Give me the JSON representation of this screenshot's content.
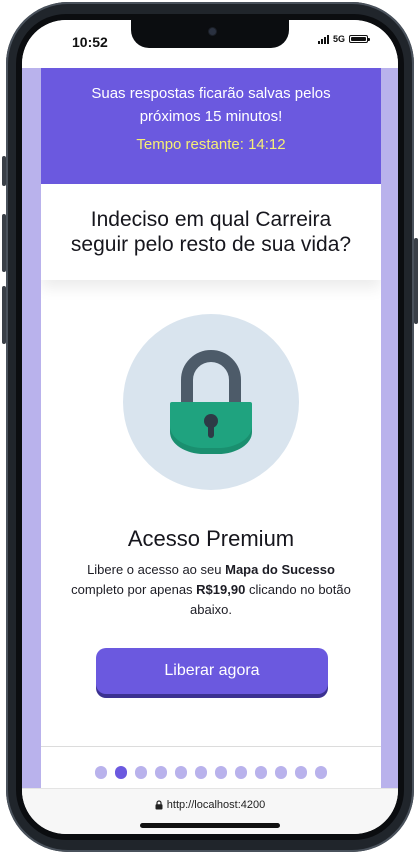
{
  "status_bar": {
    "time": "10:52",
    "network": "5G"
  },
  "banner": {
    "message": "Suas respostas ficarão salvas pelos próximos 15 minutos!",
    "timer": "Tempo restante: 14:12",
    "background_color": "#6b59df",
    "timer_color": "#f6ef74"
  },
  "question": "Indeciso em qual Carreira seguir pelo resto de sua vida?",
  "premium": {
    "icon": "padlock-icon",
    "title": "Acesso Premium",
    "description_pre": "Libere o acesso ao seu ",
    "description_bold_1": "Mapa do Sucesso",
    "description_mid": " completo por apenas ",
    "description_bold_2": "R$19,90",
    "description_post": " clicando no botão abaixo."
  },
  "cta": {
    "label": "Liberar agora"
  },
  "pagination": {
    "total": 12,
    "active_index": 1
  },
  "browser": {
    "url": "http://localhost:4200"
  },
  "colors": {
    "accent": "#6b59df",
    "accent_light": "#b9b2ec",
    "lock_green": "#1fa37f"
  }
}
